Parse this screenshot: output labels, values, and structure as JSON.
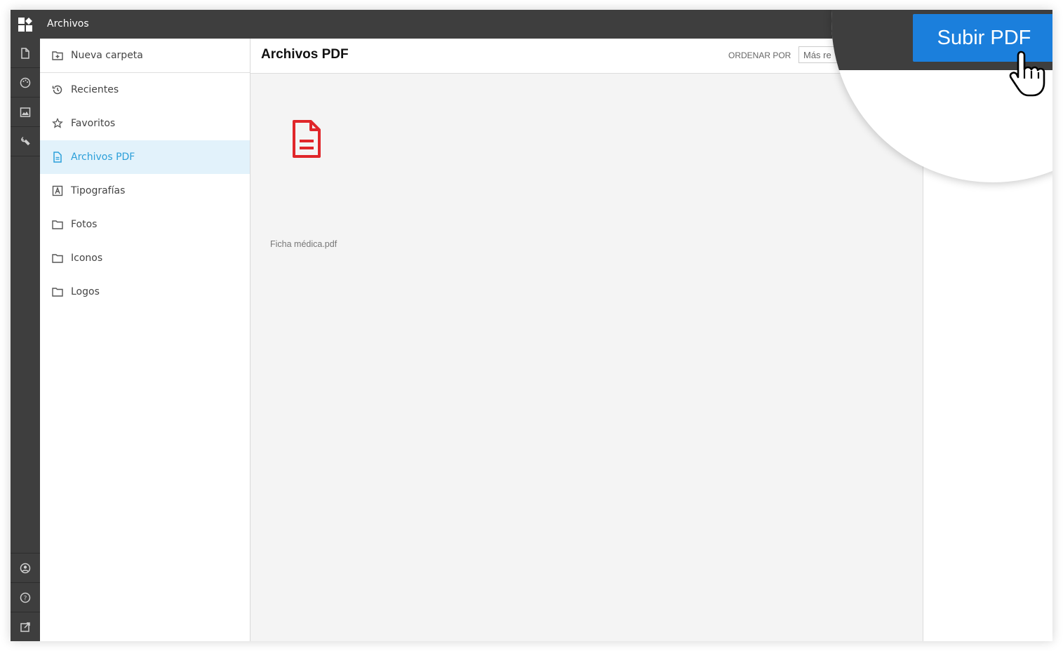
{
  "app": {
    "title": "Archivos"
  },
  "rail": {
    "top_icons": [
      "document-icon",
      "palette-icon",
      "image-icon",
      "wrench-icon"
    ],
    "bottom_icons": [
      "user-icon",
      "help-icon",
      "external-link-icon"
    ]
  },
  "sidebar": {
    "new_folder": "Nueva carpeta",
    "items": [
      {
        "label": "Recientes",
        "icon": "history-icon",
        "active": false
      },
      {
        "label": "Favoritos",
        "icon": "star-icon",
        "active": false
      },
      {
        "label": "Archivos PDF",
        "icon": "pdf-icon",
        "active": true
      },
      {
        "label": "Tipografías",
        "icon": "font-icon",
        "active": false
      },
      {
        "label": "Fotos",
        "icon": "folder-icon",
        "active": false
      },
      {
        "label": "Iconos",
        "icon": "folder-icon",
        "active": false
      },
      {
        "label": "Logos",
        "icon": "folder-icon",
        "active": false
      }
    ]
  },
  "main": {
    "title": "Archivos PDF",
    "sort_label": "ORDENAR POR",
    "sort_value": "Más re"
  },
  "files": [
    {
      "name": "Ficha médica.pdf",
      "icon": "pdf-file-icon"
    }
  ],
  "upload_button": "Subir PDF",
  "colors": {
    "accent": "#1b7fdc",
    "active_text": "#2b9fd9",
    "active_bg": "#e2f2fb",
    "pdf_red": "#e0262a",
    "bar": "#3e3e3e"
  }
}
